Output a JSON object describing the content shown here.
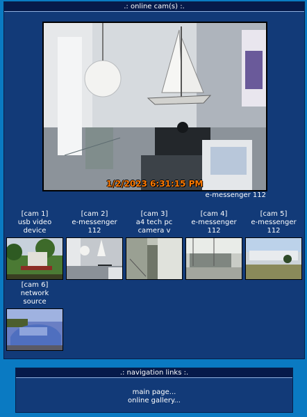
{
  "cam_panel": {
    "title": ".: online cam(s) :."
  },
  "main_cam": {
    "timestamp": "1/2/2023 6:31:15 PM",
    "caption": "e-messenger 112"
  },
  "thumbs": [
    {
      "label": "[cam 1]",
      "name1": "usb video",
      "name2": "device"
    },
    {
      "label": "[cam 2]",
      "name1": "e-messenger",
      "name2": "112"
    },
    {
      "label": "[cam 3]",
      "name1": "a4 tech pc",
      "name2": "camera v"
    },
    {
      "label": "[cam 4]",
      "name1": "e-messenger",
      "name2": "112"
    },
    {
      "label": "[cam 5]",
      "name1": "e-messenger",
      "name2": "112"
    },
    {
      "label": "[cam 6]",
      "name1": "network",
      "name2": "source"
    }
  ],
  "nav_panel": {
    "title": ".: navigation links :.",
    "links": [
      "main page...",
      "online gallery..."
    ]
  },
  "colors": {
    "page_background": "#0a7ac2",
    "panel": "#123a78",
    "header": "#061a4a",
    "timestamp": "#ff7a00"
  }
}
